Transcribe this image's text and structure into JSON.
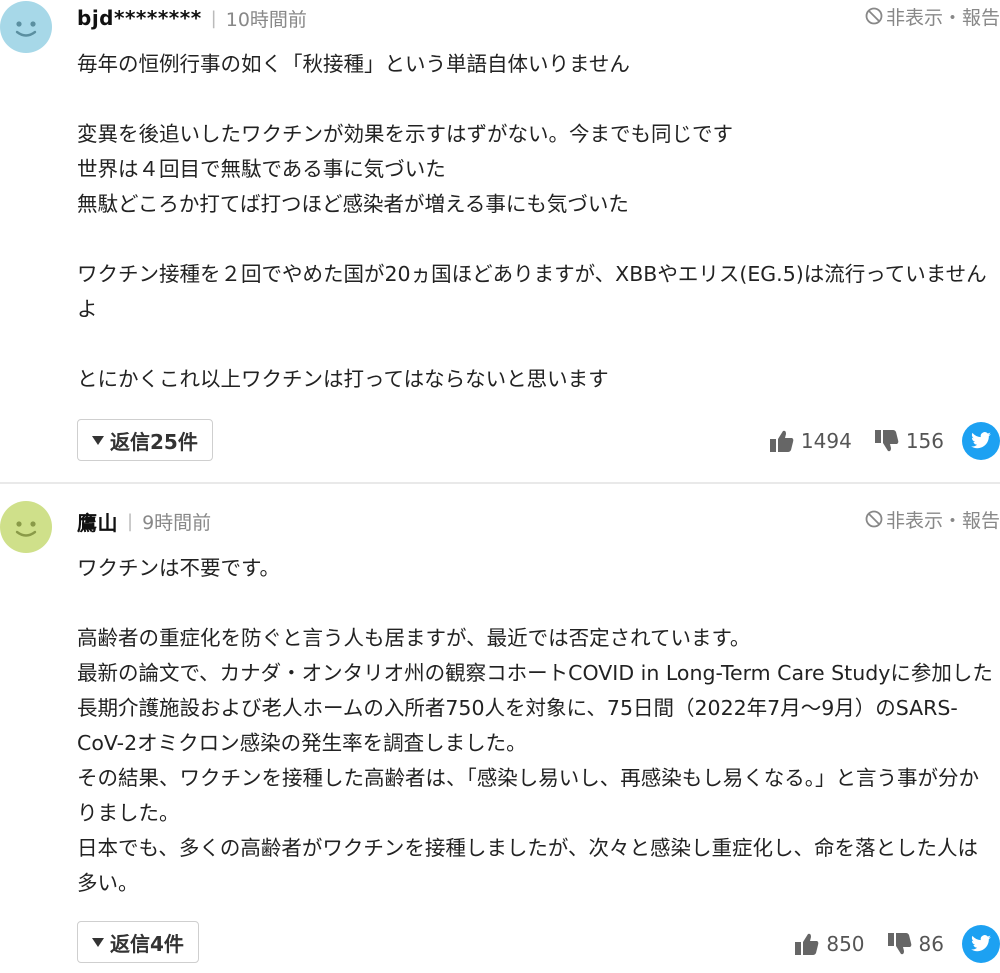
{
  "comments": [
    {
      "username": "bjd********",
      "time": "10時間前",
      "hide_report": "非表示・報告",
      "body": "毎年の恒例行事の如く「秋接種」という単語自体いりません\n\n変異を後追いしたワクチンが効果を示すはずがない。今までも同じです\n世界は４回目で無駄である事に気づいた\n無駄どころか打てば打つほど感染者が増える事にも気づいた\n\nワクチン接種を２回でやめた国が20ヵ国ほどありますが、XBBやエリス(EG.5)は流行っていませんよ\n\nとにかくこれ以上ワクチンは打ってはならないと思います",
      "reply_label": "返信25件",
      "likes": "1494",
      "dislikes": "156",
      "avatar_color": "#a7d8e8"
    },
    {
      "username": "鷹山",
      "time": "9時間前",
      "hide_report": "非表示・報告",
      "body": "ワクチンは不要です。\n\n高齢者の重症化を防ぐと言う人も居ますが、最近では否定されています。\n最新の論文で、カナダ・オンタリオ州の観察コホートCOVID in Long-Term Care Study​に参加した長期介護施設および老人ホームの入所者750人を対象に、75日間（2022年7月～9月）のSARS-CoV-2オミクロン感染の発生率を調査しました。\nその結果、ワクチンを接種した高齢者は、「感染し易いし、再感染もし易くなる。」と言う事が分かりました。\n日本でも、多くの高齢者がワクチンを接種しましたが、次々と感染し重症化し、命を落とした人は多い。",
      "reply_label": "返信4件",
      "likes": "850",
      "dislikes": "86",
      "avatar_color": "#cfe08a"
    }
  ],
  "colors": {
    "twitter": "#1da1f2",
    "meta_text": "#888888",
    "body_text": "#222222"
  },
  "icons": {
    "avatar": "smiley-face-icon",
    "hide": "ban-icon",
    "like": "thumbs-up-icon",
    "dislike": "thumbs-down-icon",
    "share": "twitter-icon",
    "expand": "caret-down-icon"
  }
}
